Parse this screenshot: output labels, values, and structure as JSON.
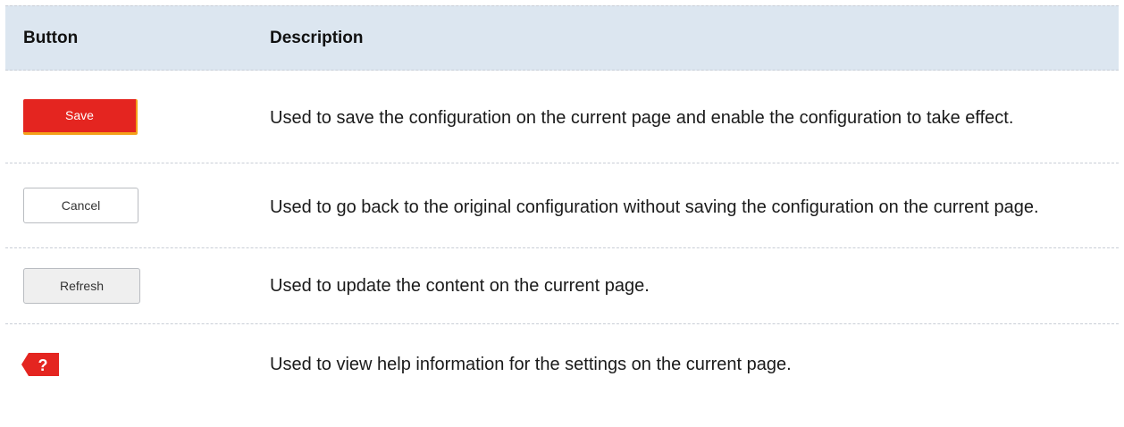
{
  "table": {
    "headers": {
      "button": "Button",
      "description": "Description"
    },
    "rows": [
      {
        "button_label": "Save",
        "description": "Used to save the configuration on the current page and enable the configuration to take effect."
      },
      {
        "button_label": "Cancel",
        "description": "Used to go back to the original configuration without saving the configuration on the current page."
      },
      {
        "button_label": "Refresh",
        "description": "Used to update the content on the current page."
      },
      {
        "button_label": "?",
        "icon": "help-icon",
        "description": "Used to view help information for the settings on the current page."
      }
    ]
  },
  "colors": {
    "header_background": "#dce6f0",
    "save_button": "#e42520",
    "save_button_accent": "#f4a11a",
    "help_icon": "#e42520"
  }
}
